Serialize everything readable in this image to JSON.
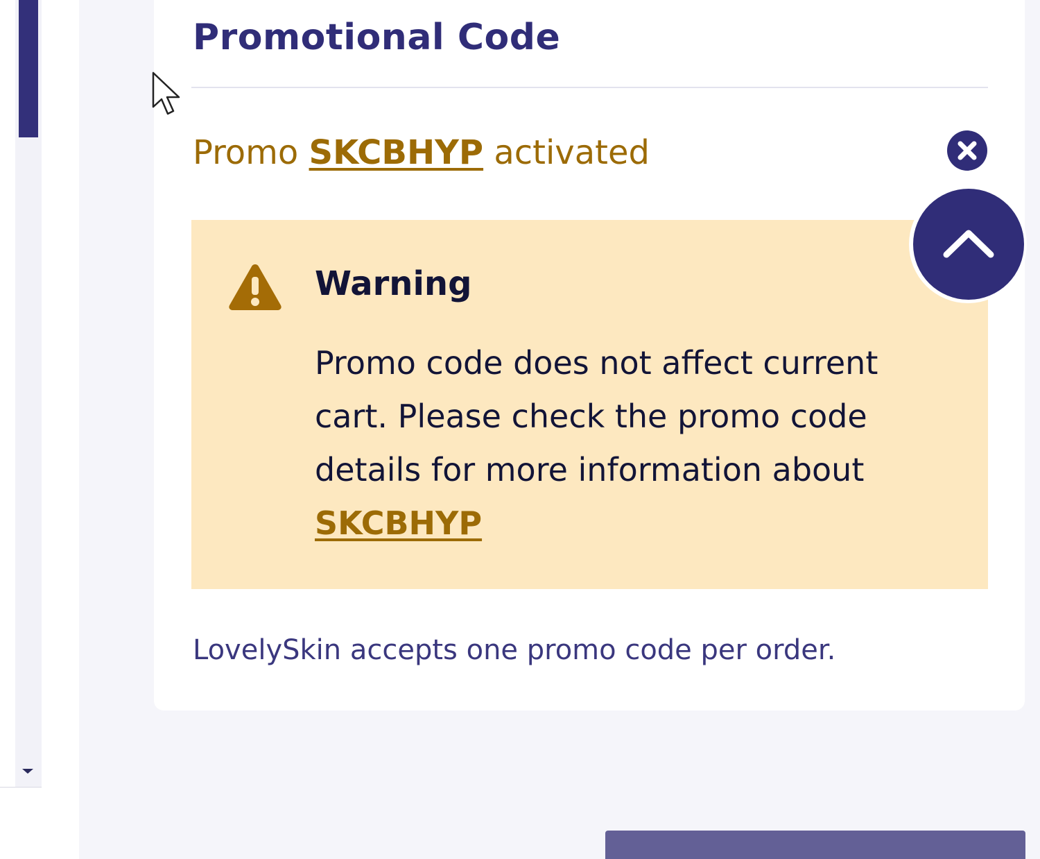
{
  "promo_panel": {
    "title": "Promotional Code",
    "status_prefix": "Promo",
    "code": "SKCBHYP",
    "status_suffix": "activated",
    "remove_icon": "close-circle-icon"
  },
  "warning": {
    "icon": "warning-triangle-icon",
    "title": "Warning",
    "message": "Promo code does not affect current cart. Please check the promo code details for more information about",
    "code_link": "SKCBHYP"
  },
  "policy_note": "LovelySkin accepts one promo code per order.",
  "scroll_to_top": {
    "icon": "chevron-up-icon"
  },
  "colors": {
    "brand": "#302d78",
    "promo_text": "#9c6b06",
    "warning_bg": "#fde8c0",
    "page_bg": "#f5f5fa"
  }
}
